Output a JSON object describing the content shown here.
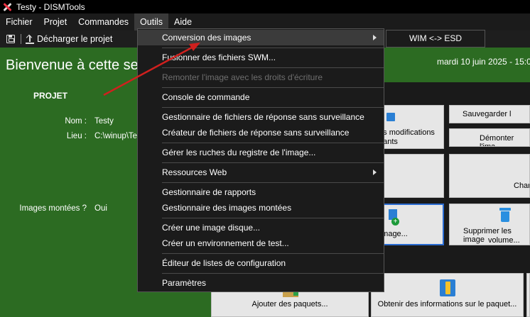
{
  "window": {
    "title": "Testy - DISMTools"
  },
  "menubar": [
    "Fichier",
    "Projet",
    "Commandes",
    "Outils",
    "Aide"
  ],
  "toolbar": {
    "unload_label": "Décharger le projet"
  },
  "welcome": {
    "heading": "Bienvenue à cette se",
    "date": "mardi 10 juin 2025 - 15:00"
  },
  "project": {
    "section_title": "PROJET",
    "name_label": "Nom :",
    "name_value": "Testy",
    "location_label": "Lieu :",
    "location_value": "C:\\winup\\Te",
    "mounted_label": "Images montées ?",
    "mounted_value": "Oui"
  },
  "tasks": {
    "save_changes": "es modifications",
    "save_changes_2": "dants",
    "save_label": "Sauvegarder l",
    "unmount_label": "Démonter l'ima",
    "change_label": "Char",
    "add_image_label": "r image...",
    "delete_image_label": "Supprimer les image",
    "delete_image_label_2": "volume...",
    "add_packages_label": "Ajouter des paquets...",
    "package_info_label": "Obtenir des informations sur le paquet..."
  },
  "outils_menu": {
    "items": [
      "Conversion des images",
      "Fusionner des fichiers SWM...",
      "Remonter l'image avec les droits d'écriture",
      "Console de commande",
      "Gestionnaire de fichiers de réponse sans surveillance",
      "Créateur de fichiers de réponse sans surveillance",
      "Gérer les ruches du registre de l'image...",
      "Ressources Web",
      "Gestionnaire de rapports",
      "Gestionnaire des images montées",
      "Créer une image disque...",
      "Créer un environnement de test...",
      "Éditeur de listes de configuration",
      "Paramètres"
    ]
  },
  "submenu": {
    "item": "WIM <-> ESD"
  },
  "colors": {
    "project_green": "#2c6b22",
    "menu_bg": "#1b1b1b",
    "annotation_red": "#d0201e"
  }
}
